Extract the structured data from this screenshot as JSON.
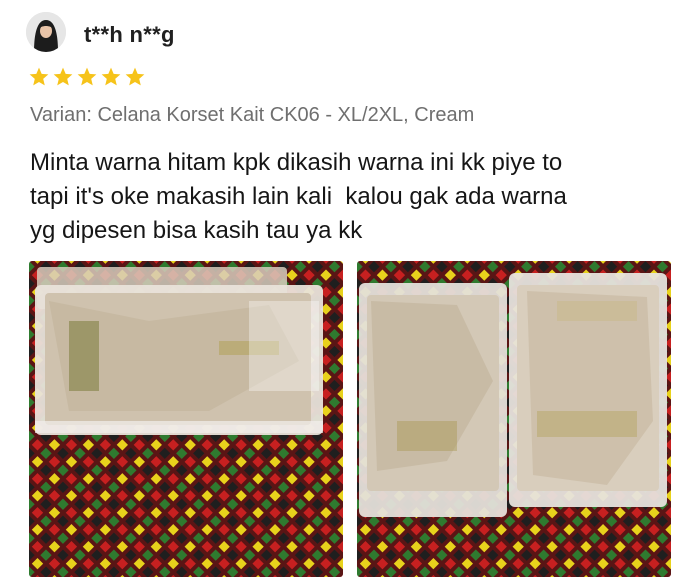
{
  "review": {
    "username": "t**h n**g",
    "rating": 5,
    "rating_max": 5,
    "variant": "Varian: Celana Korset Kait CK06 - XL/2XL, Cream",
    "text_lines": [
      "Minta warna hitam kpk dikasih warna ini kk piye to",
      "tapi it's oke makasih lain kali  kalou gak ada warna",
      "yg dipesen bisa kasih tau ya kk"
    ]
  },
  "photos": [
    {
      "name": "review-photo-1"
    },
    {
      "name": "review-photo-2"
    }
  ],
  "colors": {
    "star": "#f6c31a",
    "variant_text": "#6f6f6f",
    "body_text": "#161616"
  },
  "icons": {
    "avatar": "avatar",
    "star": "star-icon"
  }
}
